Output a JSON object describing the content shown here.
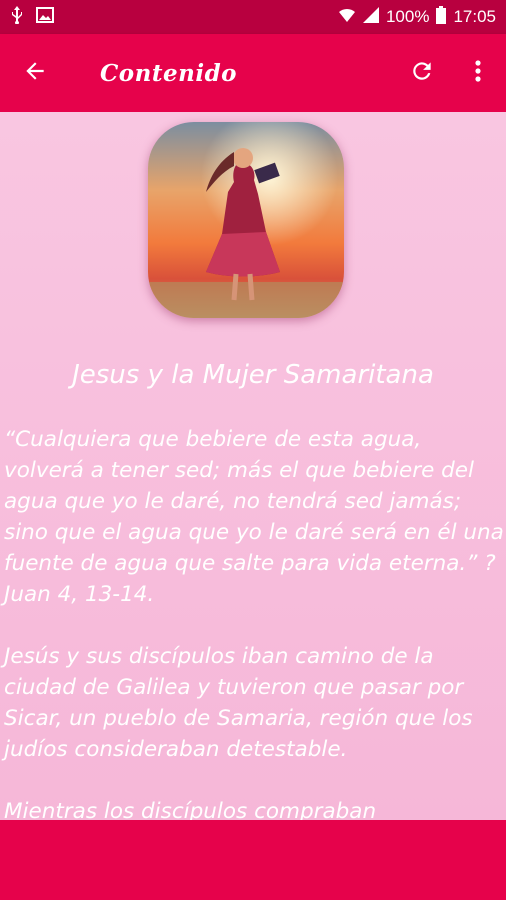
{
  "status_bar": {
    "icons_left": [
      "usb-icon",
      "image-icon"
    ],
    "icons_right": [
      "wifi-icon",
      "signal-icon"
    ],
    "battery": "100%",
    "time": "17:05"
  },
  "toolbar": {
    "title": "Contenido",
    "back_icon": "arrow-back-icon",
    "refresh_icon": "refresh-icon",
    "menu_icon": "more-vert-icon"
  },
  "article": {
    "title": "Jesus y la Mujer Samaritana",
    "paragraphs": [
      "“Cualquiera que bebiere de esta agua, volverá a tener sed; más el que bebiere del agua que yo le daré, no tendrá sed jamás; sino que el agua que yo le daré será en él una fuente de agua que salte para vida eterna.” ?Juan 4, 13-14.",
      "Jesús y sus discípulos iban camino de la ciudad de Galilea y tuvieron que pasar por Sicar, un pueblo de Samaria, región que los judíos consideraban detestable.",
      "Mientras los discípulos compraban"
    ]
  },
  "colors": {
    "status_bar": "#b8003f",
    "toolbar": "#e6024b",
    "background": "#f7bfdc",
    "text": "#ffffff"
  }
}
